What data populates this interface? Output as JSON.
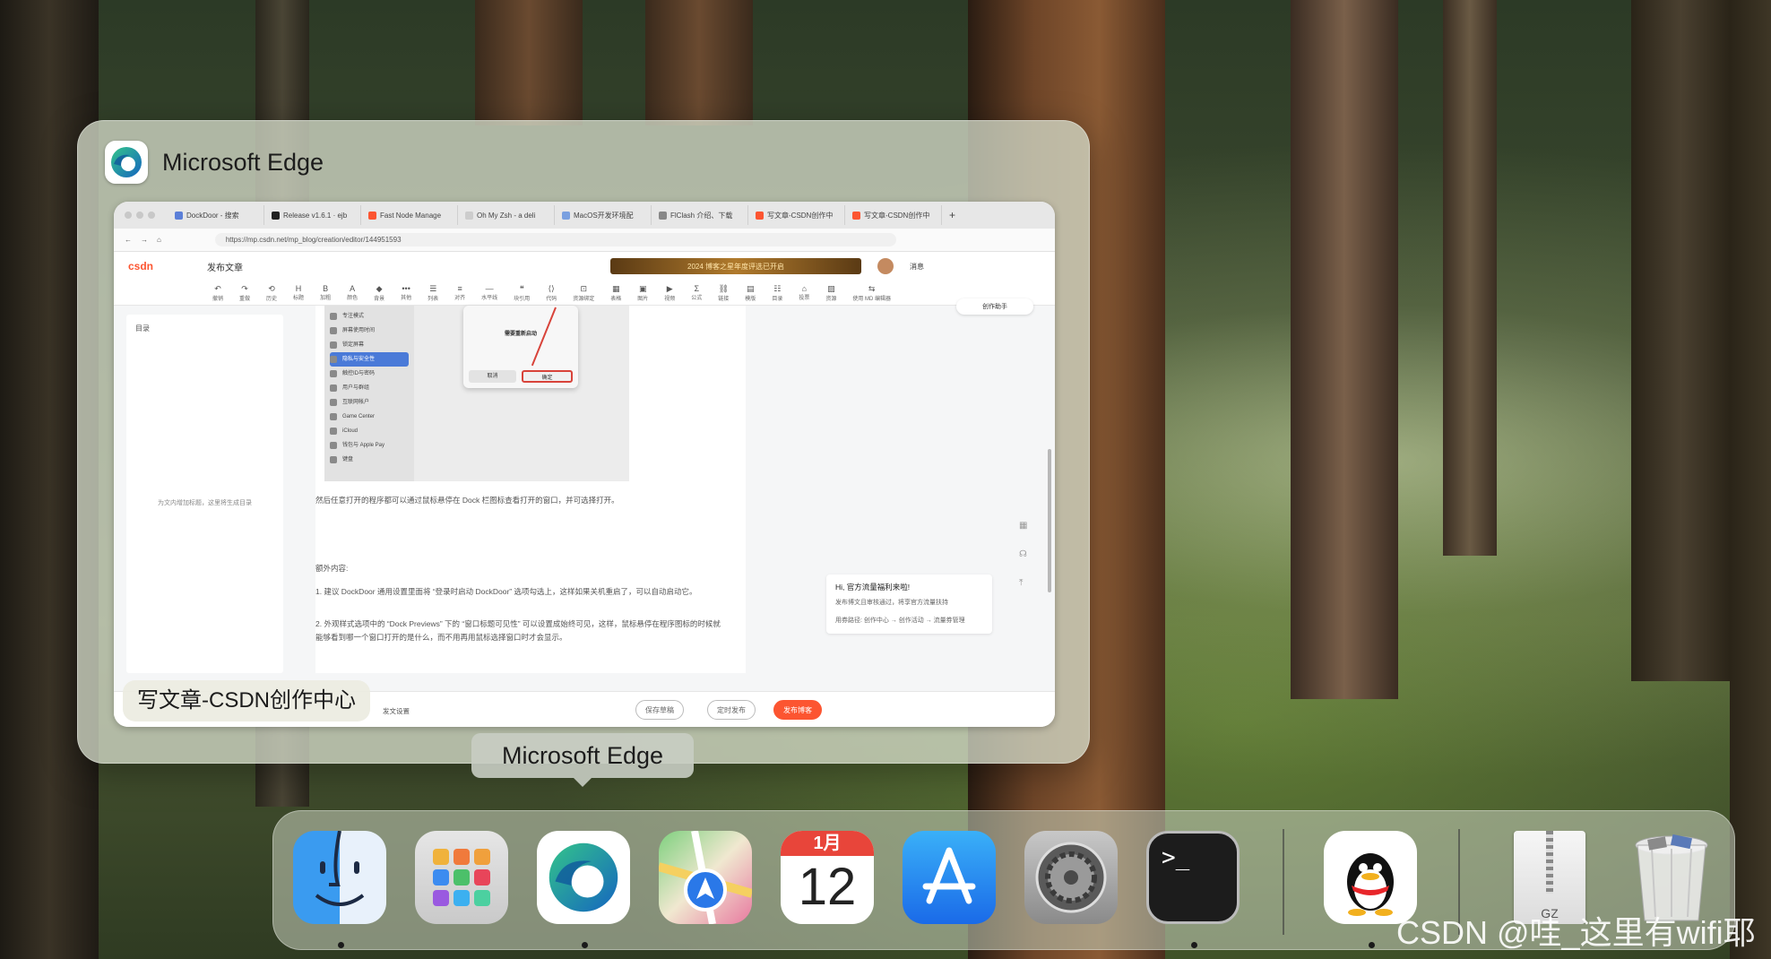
{
  "preview": {
    "app_name": "Microsoft Edge",
    "window_title": "写文章-CSDN创作中心"
  },
  "browser": {
    "tabs": [
      {
        "label": "DockDoor - 搜索",
        "color": "#5b7fd8"
      },
      {
        "label": "Release v1.6.1 · ejb",
        "color": "#222222"
      },
      {
        "label": "Fast Node Manage",
        "color": "#fc5531"
      },
      {
        "label": "Oh My Zsh - a deli",
        "color": "#cccccc"
      },
      {
        "label": "MacOS开发环境配",
        "color": "#7aa0e0"
      },
      {
        "label": "FlClash 介绍、下载",
        "color": "#888888"
      },
      {
        "label": "写文章-CSDN创作中",
        "color": "#fc5531"
      },
      {
        "label": "写文章-CSDN创作中",
        "color": "#fc5531"
      }
    ],
    "url": "https://mp.csdn.net/mp_blog/creation/editor/144951593"
  },
  "csdn": {
    "logo": "csdn",
    "publish_menu": "发布文章",
    "banner": "2024 博客之星年度评选已开启",
    "messages": "消息",
    "toolbar": [
      {
        "icon": "↶",
        "label": "撤销"
      },
      {
        "icon": "↷",
        "label": "重做"
      },
      {
        "icon": "⟲",
        "label": "历史"
      },
      {
        "icon": "H",
        "label": "标题"
      },
      {
        "icon": "B",
        "label": "加粗"
      },
      {
        "icon": "A",
        "label": "颜色"
      },
      {
        "icon": "◆",
        "label": "背景"
      },
      {
        "icon": "•••",
        "label": "其他"
      },
      {
        "icon": "☰",
        "label": "列表"
      },
      {
        "icon": "≡",
        "label": "对齐"
      },
      {
        "icon": "—",
        "label": "水平线"
      },
      {
        "icon": "❝",
        "label": "块引用"
      },
      {
        "icon": "⟨⟩",
        "label": "代码"
      },
      {
        "icon": "⊡",
        "label": "资源绑定"
      },
      {
        "icon": "▦",
        "label": "表格"
      },
      {
        "icon": "▣",
        "label": "图片"
      },
      {
        "icon": "▶",
        "label": "视频"
      },
      {
        "icon": "Σ",
        "label": "公式"
      },
      {
        "icon": "⛓",
        "label": "链接"
      },
      {
        "icon": "▤",
        "label": "模版"
      },
      {
        "icon": "☷",
        "label": "目录"
      },
      {
        "icon": "⌂",
        "label": "投票"
      },
      {
        "icon": "▨",
        "label": "资源"
      },
      {
        "icon": "⇆",
        "label": "使用 MD 编辑器"
      }
    ],
    "toc_title": "目录",
    "toc_empty": "为文内增加标题，这里将生成目录",
    "inner_sidebar": [
      "专注模式",
      "屏幕使用时间",
      "锁定屏幕",
      "隐私与安全性",
      "触控ID与密码",
      "用户与群组",
      "互联网帐户",
      "Game Center",
      "iCloud",
      "钱包与 Apple Pay",
      "键盘"
    ],
    "dialog_title": "需要重新启动",
    "dialog_cancel": "取消",
    "dialog_ok": "确定",
    "paragraphs": [
      "然后任意打开的程序都可以通过鼠标悬停在 Dock 栏图标查看打开的窗口，并可选择打开。",
      "额外内容:",
      "1. 建议 DockDoor 通用设置里面将 “登录时启动 DockDoor” 选项勾选上，这样如果关机重启了，可以自动启动它。",
      "2. 外观样式选项中的 “Dock Previews” 下的 “窗口标题可见性” 可以设置成始终可见，这样，鼠标悬停在程序图标的时候就能够看到哪一个窗口打开的是什么，而不用再用鼠标选择窗口时才会显示。"
    ],
    "assistant": "创作助手",
    "promo_title": "Hi, 官方流量福利来啦!",
    "promo_text": "发布博文且审核通过，将享官方流量扶持",
    "promo_path": "用券路径: 创作中心 → 创作活动 → 流量券管理",
    "footer_settings": "发文设置",
    "footer_save": "保存草稿",
    "footer_schedule": "定时发布",
    "footer_publish": "发布博客"
  },
  "dock": {
    "tooltip": "Microsoft Edge",
    "items": [
      {
        "name": "Finder",
        "icon": "finder-icon",
        "running": true
      },
      {
        "name": "Launchpad",
        "icon": "launchpad-icon",
        "running": false
      },
      {
        "name": "Microsoft Edge",
        "icon": "edge-icon",
        "running": true
      },
      {
        "name": "Maps",
        "icon": "maps-icon",
        "running": false
      },
      {
        "name": "Calendar",
        "icon": "calendar-icon",
        "running": false,
        "month": "1月",
        "day": "12"
      },
      {
        "name": "App Store",
        "icon": "app-store-icon",
        "running": false
      },
      {
        "name": "System Settings",
        "icon": "system-settings-icon",
        "running": false
      },
      {
        "name": "Terminal",
        "icon": "terminal-icon",
        "running": true,
        "prompt": ">_"
      },
      {
        "name": "QQ",
        "icon": "qq-icon",
        "running": true
      },
      {
        "name": "Archive",
        "icon": "archive-icon",
        "running": false,
        "label": "GZ"
      },
      {
        "name": "Trash",
        "icon": "trash-icon",
        "running": false
      }
    ]
  },
  "watermark": "CSDN @哇_这里有wifi耶"
}
